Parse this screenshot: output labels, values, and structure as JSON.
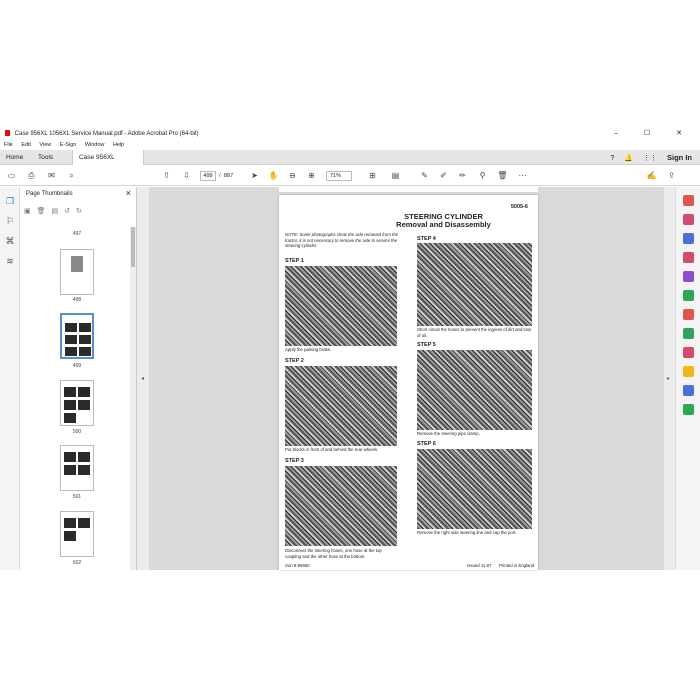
{
  "window": {
    "title": "Case 956XL 1056XL Service Manual.pdf - Adobe Acrobat Pro (64-bit)",
    "controls": "–  ☐  ✕"
  },
  "menu": [
    "File",
    "Edit",
    "View",
    "E-Sign",
    "Window",
    "Help"
  ],
  "tabs": {
    "home": "Home",
    "tools": "Tools",
    "doc": "Case 956XL 1056X...",
    "doc_close": "×"
  },
  "account": {
    "signin": "Sign In"
  },
  "toolbar": {
    "page_current": "499",
    "page_sep": "/",
    "page_total": "887",
    "zoom": "71%"
  },
  "thumbnails": {
    "title": "Page Thumbnails",
    "close": "×",
    "pages": [
      "497",
      "498",
      "499",
      "500",
      "501",
      "502"
    ]
  },
  "page": {
    "section": "5005-6",
    "title1": "STEERING CYLINDER",
    "title2": "Removal and Disassembly",
    "note": "NOTE: Some photographs show the axle removed from the tractor, it is not necessary to remove the axle to service the steering cylinder.",
    "steps": [
      {
        "label": "STEP 1",
        "caption": "Apply the parking brake."
      },
      {
        "label": "STEP 2",
        "caption": "Put blocks in front of and behind the rear wheels."
      },
      {
        "label": "STEP 3",
        "caption": "Disconnect the steering hoses, one hose at the top coupling and the other hose at the bottom."
      },
      {
        "label": "STEP 4",
        "caption": "Short circuit the hoses to prevent the ingress of dirt and loss of oil."
      },
      {
        "label": "STEP 5",
        "caption": "Remove the steering pipe clamp."
      },
      {
        "label": "STEP 6",
        "caption": "Remove the right side steering line and cap the port."
      }
    ],
    "footer_left": "Son 8-98650",
    "footer_issued": "Issued 11-97",
    "footer_printed": "Printed in England"
  }
}
